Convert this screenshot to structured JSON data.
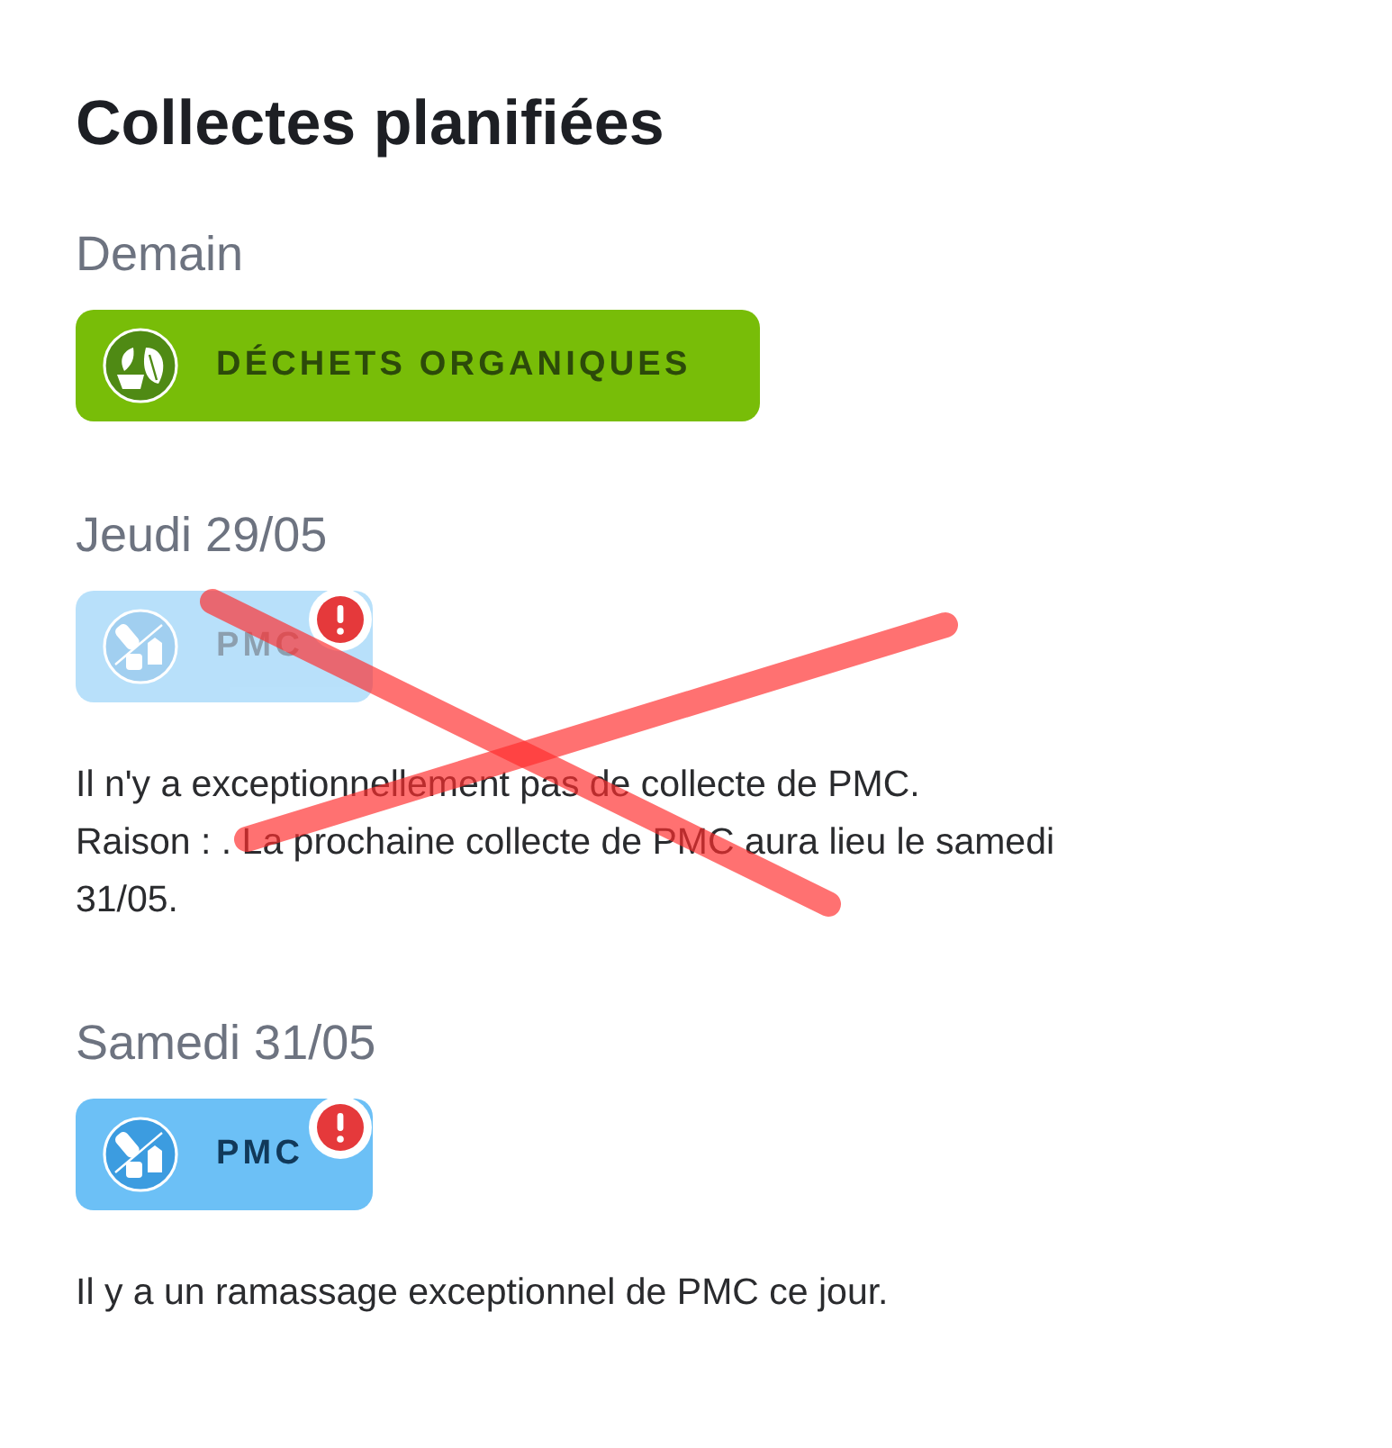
{
  "title": "Collectes planifiées",
  "days": [
    {
      "label": "Demain",
      "crossed_out": false,
      "collections": [
        {
          "name": "DÉCHETS ORGANIQUES",
          "kind": "organic",
          "disabled": false,
          "alert": false
        }
      ]
    },
    {
      "label": "Jeudi 29/05",
      "crossed_out": true,
      "collections": [
        {
          "name": "PMC",
          "kind": "pmc",
          "disabled": true,
          "alert": true
        }
      ],
      "notes": [
        "Il n'y a exceptionnellement pas de collecte de PMC.",
        "Raison : . La prochaine collecte de PMC aura lieu le samedi 31/05."
      ]
    },
    {
      "label": "Samedi 31/05",
      "crossed_out": false,
      "collections": [
        {
          "name": "PMC",
          "kind": "pmc",
          "disabled": false,
          "alert": true
        }
      ],
      "notes": [
        "Il y a un ramassage exceptionnel de PMC ce jour."
      ]
    }
  ]
}
